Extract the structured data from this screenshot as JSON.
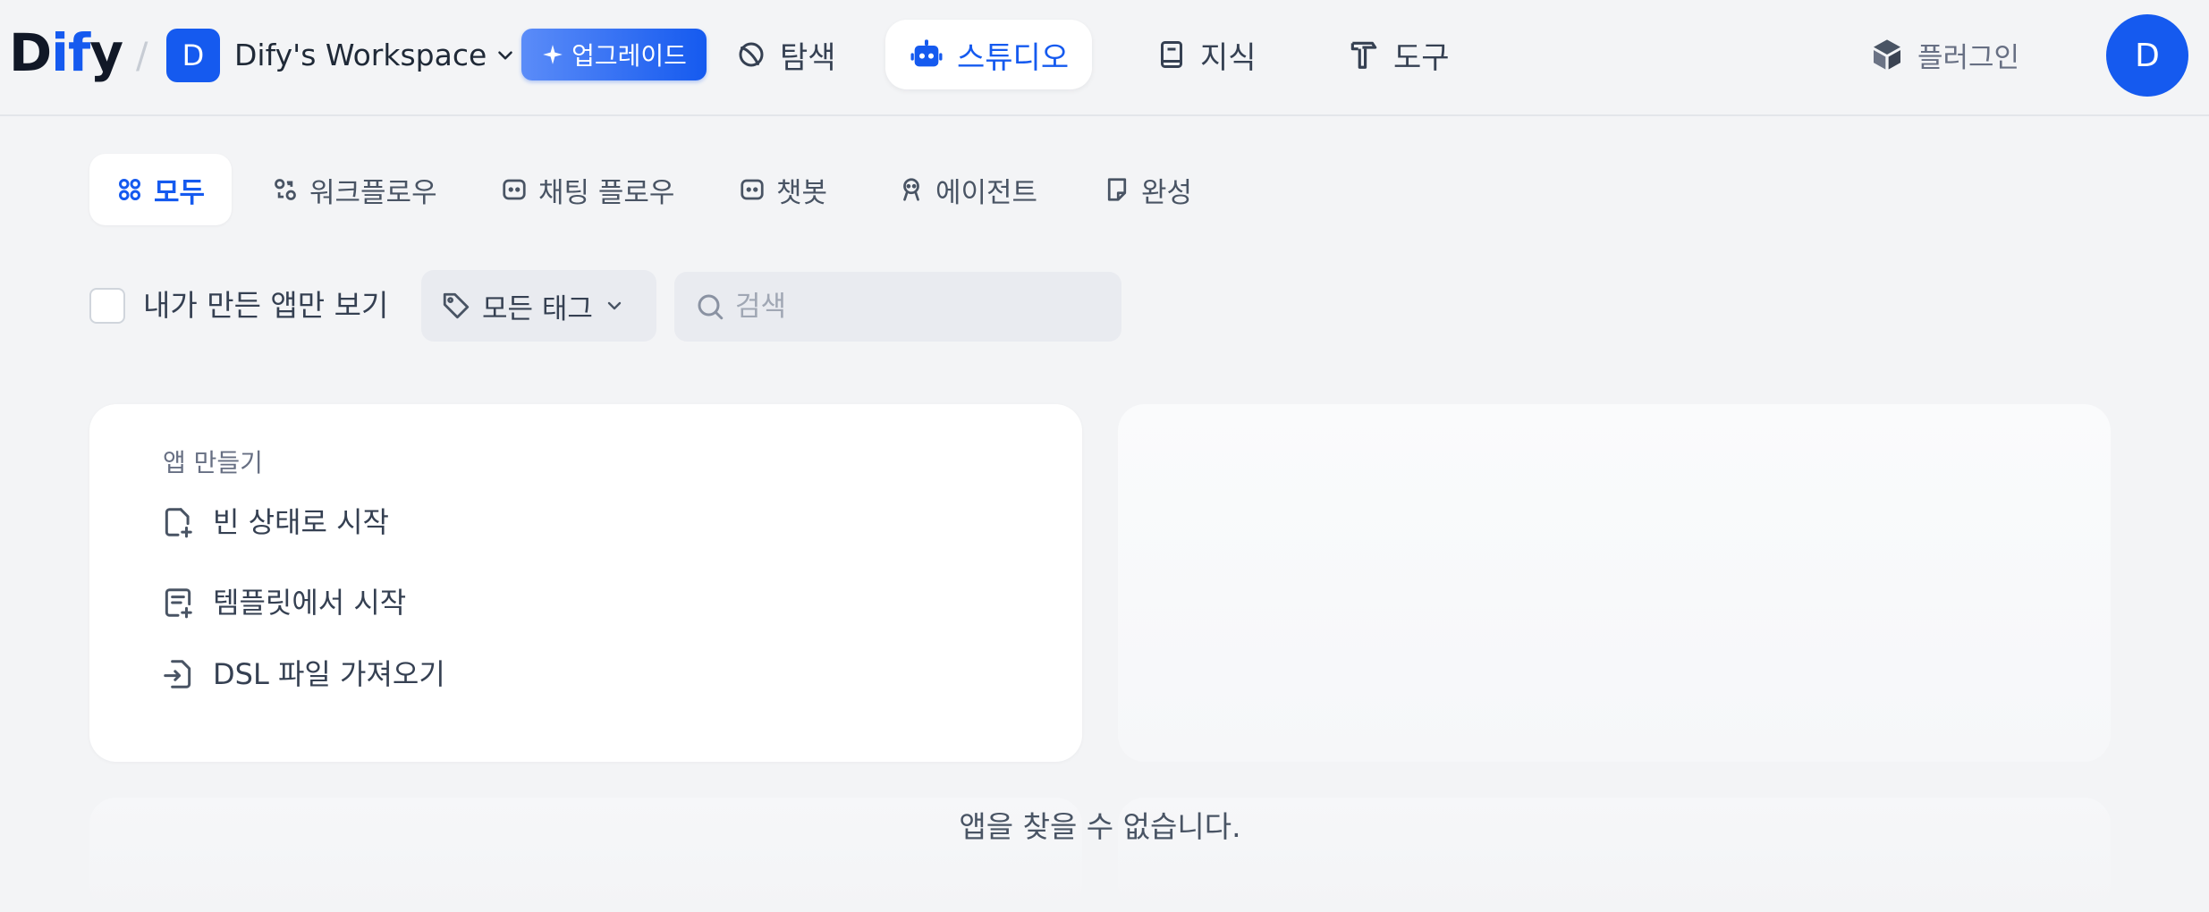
{
  "header": {
    "logo_prefix": "D",
    "logo_blue": "if",
    "logo_suffix": "y",
    "workspace_initial": "D",
    "workspace_name": "Dify's Workspace",
    "upgrade_label": "업그레이드",
    "nav": [
      {
        "label": "탐색",
        "icon": "explore-icon"
      },
      {
        "label": "스튜디오",
        "icon": "robot-icon",
        "active": true
      },
      {
        "label": "지식",
        "icon": "book-icon"
      },
      {
        "label": "도구",
        "icon": "hammer-icon"
      }
    ],
    "plugin_label": "플러그인",
    "user_initial": "D"
  },
  "categories": [
    {
      "label": "모두",
      "icon": "grid-icon",
      "active": true
    },
    {
      "label": "워크플로우",
      "icon": "workflow-icon"
    },
    {
      "label": "채팅 플로우",
      "icon": "chat-flow-icon"
    },
    {
      "label": "챗봇",
      "icon": "chatbot-icon"
    },
    {
      "label": "에이전트",
      "icon": "agent-icon"
    },
    {
      "label": "완성",
      "icon": "completion-icon"
    }
  ],
  "filters": {
    "mine_only_label": "내가 만든 앱만 보기",
    "mine_only_checked": false,
    "tag_select_label": "모든 태그",
    "search_placeholder": "검색",
    "search_value": ""
  },
  "create_card": {
    "title": "앱 만들기",
    "items": [
      {
        "label": "빈 상태로 시작",
        "icon": "file-plus-icon"
      },
      {
        "label": "템플릿에서 시작",
        "icon": "template-icon"
      },
      {
        "label": "DSL 파일 가져오기",
        "icon": "import-icon"
      }
    ]
  },
  "empty_message": "앱을 찾을 수 없습니다.",
  "colors": {
    "accent": "#155aef",
    "background": "#f3f4f6",
    "text": "#354052"
  }
}
